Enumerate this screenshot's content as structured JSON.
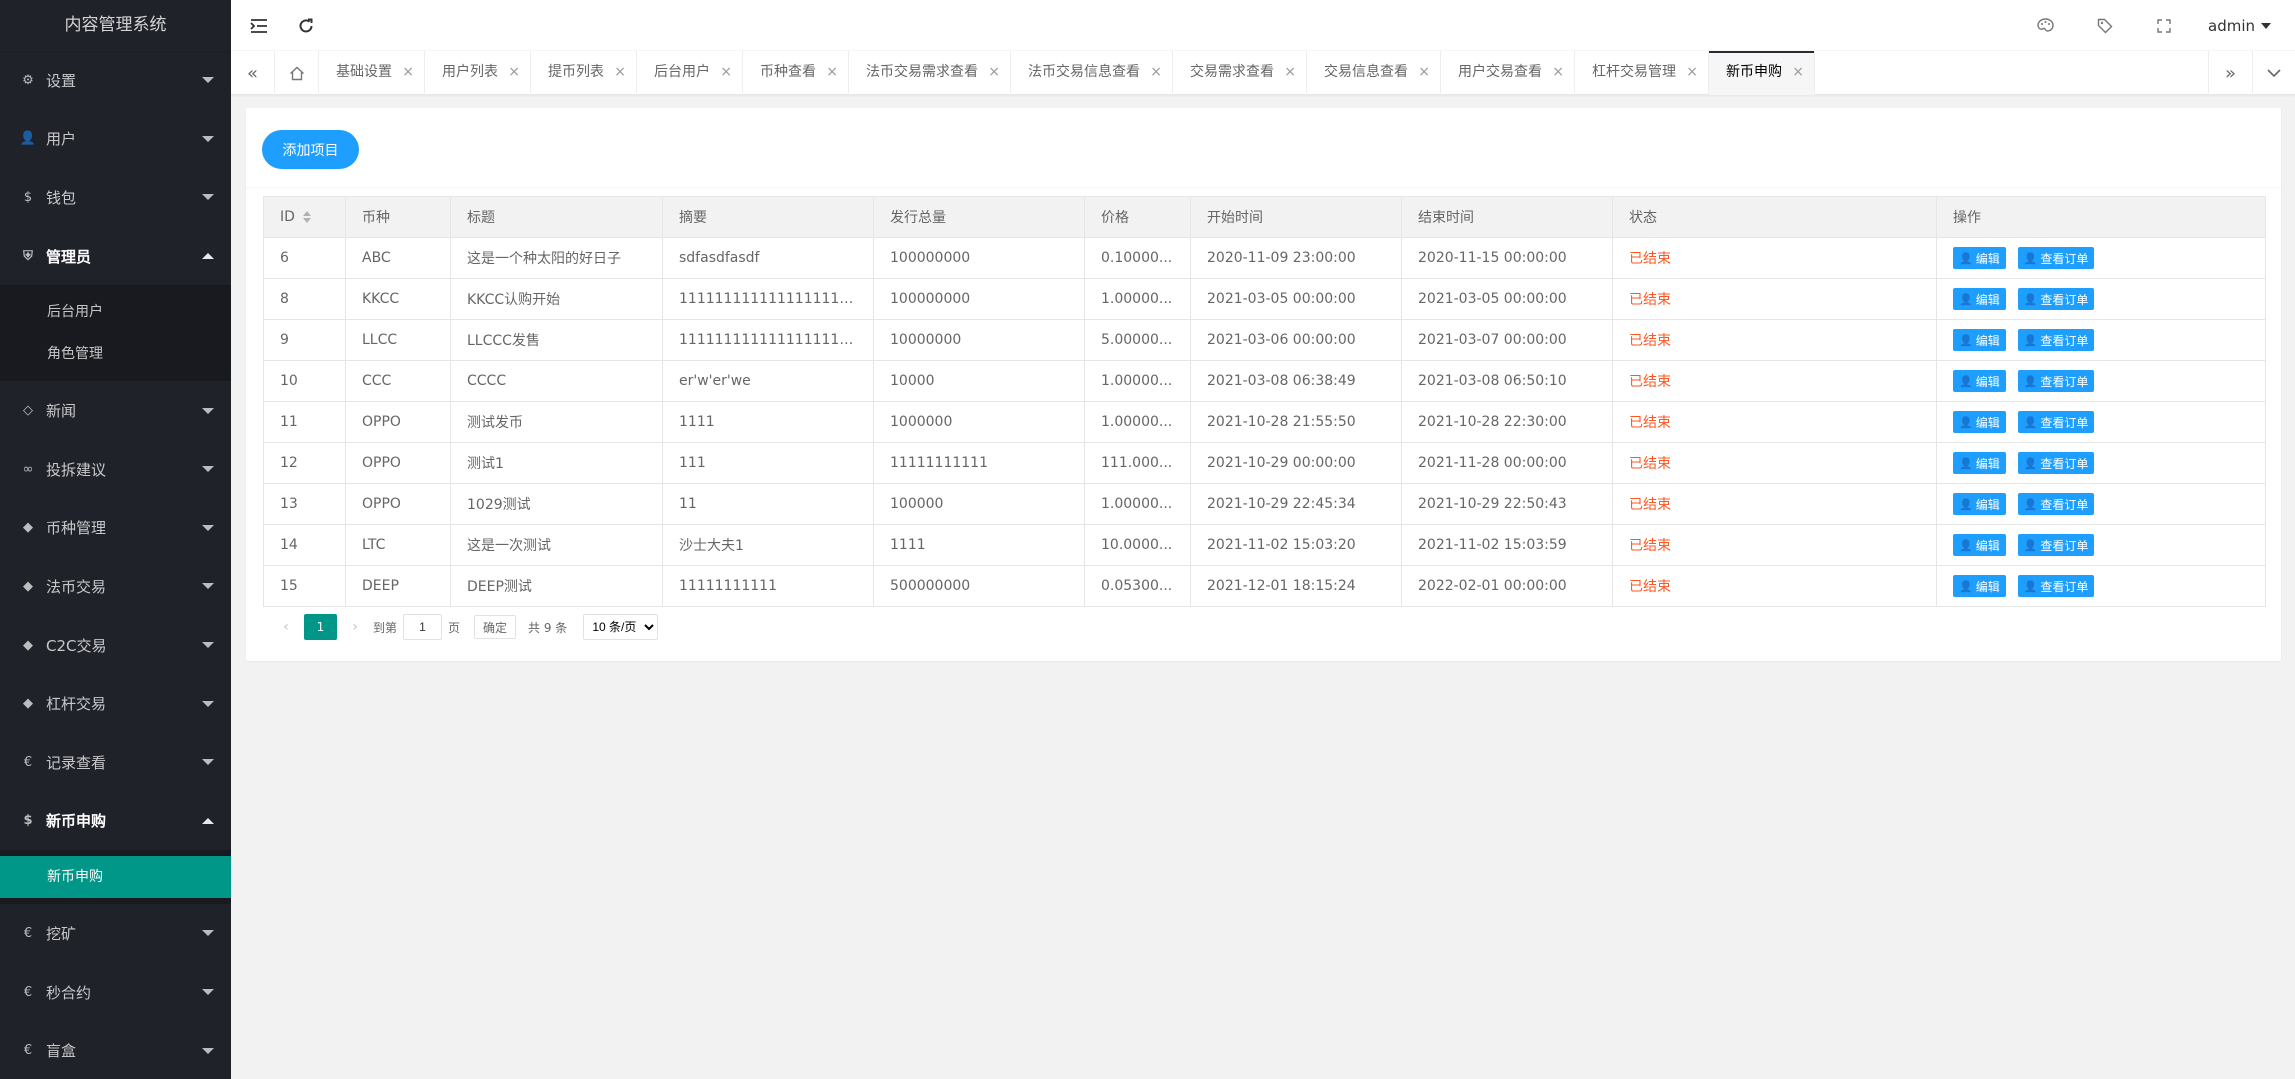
{
  "app": {
    "title": "内容管理系统"
  },
  "sidebar": {
    "items": [
      {
        "label": "设置",
        "icon": "gear-icon"
      },
      {
        "label": "用户",
        "icon": "user-icon"
      },
      {
        "label": "钱包",
        "icon": "dollar-icon"
      },
      {
        "label": "管理员",
        "icon": "shield-icon",
        "open": true,
        "children": [
          {
            "label": "后台用户"
          },
          {
            "label": "角色管理"
          }
        ]
      },
      {
        "label": "新闻",
        "icon": "tag-icon"
      },
      {
        "label": "投拆建议",
        "icon": "link-icon"
      },
      {
        "label": "币种管理",
        "icon": "diamond-icon"
      },
      {
        "label": "法币交易",
        "icon": "diamond-icon"
      },
      {
        "label": "C2C交易",
        "icon": "diamond-icon"
      },
      {
        "label": "杠杆交易",
        "icon": "diamond-icon"
      },
      {
        "label": "记录查看",
        "icon": "euro-icon"
      },
      {
        "label": "新币申购",
        "icon": "dollar-icon",
        "open": true,
        "children": [
          {
            "label": "新币申购",
            "active": true
          }
        ]
      },
      {
        "label": "挖矿",
        "icon": "euro-icon"
      },
      {
        "label": "秒合约",
        "icon": "euro-icon"
      },
      {
        "label": "盲盒",
        "icon": "euro-icon"
      }
    ]
  },
  "header": {
    "user": "admin"
  },
  "tabs": [
    {
      "label": "基础设置"
    },
    {
      "label": "用户列表"
    },
    {
      "label": "提币列表"
    },
    {
      "label": "后台用户"
    },
    {
      "label": "币种查看"
    },
    {
      "label": "法币交易需求查看"
    },
    {
      "label": "法币交易信息查看"
    },
    {
      "label": "交易需求查看"
    },
    {
      "label": "交易信息查看"
    },
    {
      "label": "用户交易查看"
    },
    {
      "label": "杠杆交易管理"
    },
    {
      "label": "新币申购",
      "active": true
    }
  ],
  "toolbar": {
    "add_label": "添加项目"
  },
  "table": {
    "columns": [
      "ID",
      "币种",
      "标题",
      "摘要",
      "发行总量",
      "价格",
      "开始时间",
      "结束时间",
      "状态",
      "操作"
    ],
    "edit_label": "编辑",
    "orders_label": "查看订单",
    "rows": [
      [
        "6",
        "ABC",
        "这是一个种太阳的好日子",
        "sdfasdfasdf",
        "100000000",
        "0.10000...",
        "2020-11-09 23:00:00",
        "2020-11-15 00:00:00",
        "已结束"
      ],
      [
        "8",
        "KKCC",
        "KKCC认购开始",
        "1111111111111111111111...",
        "100000000",
        "1.00000...",
        "2021-03-05 00:00:00",
        "2021-03-05 00:00:00",
        "已结束"
      ],
      [
        "9",
        "LLCC",
        "LLCCC发售",
        "1111111111111111111111...",
        "10000000",
        "5.00000...",
        "2021-03-06 00:00:00",
        "2021-03-07 00:00:00",
        "已结束"
      ],
      [
        "10",
        "CCC",
        "CCCC",
        "er'w'er'we",
        "10000",
        "1.00000...",
        "2021-03-08 06:38:49",
        "2021-03-08 06:50:10",
        "已结束"
      ],
      [
        "11",
        "OPPO",
        "测试发币",
        "1111",
        "1000000",
        "1.00000...",
        "2021-10-28 21:55:50",
        "2021-10-28 22:30:00",
        "已结束"
      ],
      [
        "12",
        "OPPO",
        "测试1",
        "111",
        "11111111111",
        "111.000...",
        "2021-10-29 00:00:00",
        "2021-11-28 00:00:00",
        "已结束"
      ],
      [
        "13",
        "OPPO",
        "1029测试",
        "11",
        "100000",
        "1.00000...",
        "2021-10-29 22:45:34",
        "2021-10-29 22:50:43",
        "已结束"
      ],
      [
        "14",
        "LTC",
        "这是一次测试",
        "沙士大夫1",
        "1111",
        "10.0000...",
        "2021-11-02 15:03:20",
        "2021-11-02 15:03:59",
        "已结束"
      ],
      [
        "15",
        "DEEP",
        "DEEP测试",
        "11111111111",
        "500000000",
        "0.05300...",
        "2021-12-01 18:15:24",
        "2022-02-01 00:00:00",
        "已结束"
      ]
    ]
  },
  "pager": {
    "current": "1",
    "goto_prefix": "到第",
    "goto_value": "1",
    "goto_suffix": "页",
    "confirm": "确定",
    "total": "共 9 条",
    "page_size": "10 条/页"
  },
  "colors": {
    "accent": "#009688",
    "primary": "#1e9fff",
    "danger": "#ff5722",
    "sidebar": "#20222a"
  }
}
